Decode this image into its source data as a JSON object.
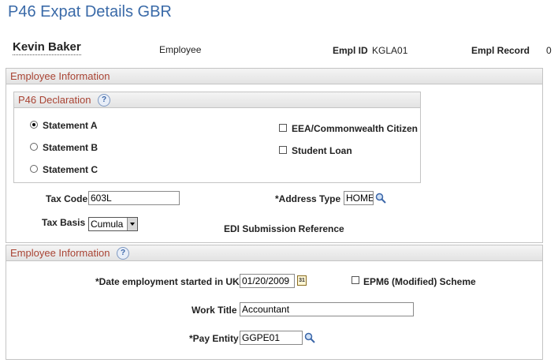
{
  "page": {
    "title": "P46 Expat Details GBR"
  },
  "employee": {
    "name": "Kevin Baker",
    "type": "Employee",
    "empl_id_label": "Empl ID",
    "empl_id": "KGLA01",
    "empl_record_label": "Empl Record",
    "empl_record": "0"
  },
  "section1": {
    "header": "Employee Information",
    "p46": {
      "header": "P46 Declaration",
      "statements": [
        {
          "label": "Statement A",
          "selected": true
        },
        {
          "label": "Statement B",
          "selected": false
        },
        {
          "label": "Statement C",
          "selected": false
        }
      ],
      "eea_label": "EEA/Commonwealth Citizen",
      "student_loan_label": "Student Loan"
    },
    "tax_code_label": "Tax Code",
    "tax_code": "603L",
    "address_type_label": "*Address Type",
    "address_type": "HOME",
    "tax_basis_label": "Tax Basis",
    "tax_basis": "Cumula",
    "edi_label": "EDI Submission Reference"
  },
  "section2": {
    "header": "Employee Information",
    "date_label": "*Date employment started in UK",
    "date": "01/20/2009",
    "epm6_label": "EPM6 (Modified) Scheme",
    "work_title_label": "Work Title",
    "work_title": "Accountant",
    "pay_entity_label": "*Pay Entity",
    "pay_entity": "GGPE01"
  },
  "icons": {
    "help": "help-icon",
    "lookup": "magnifier-icon",
    "calendar": "calendar-icon"
  },
  "colors": {
    "title": "#3a6aa8",
    "section_header_text": "#a94434",
    "border": "#c4c4c4"
  }
}
